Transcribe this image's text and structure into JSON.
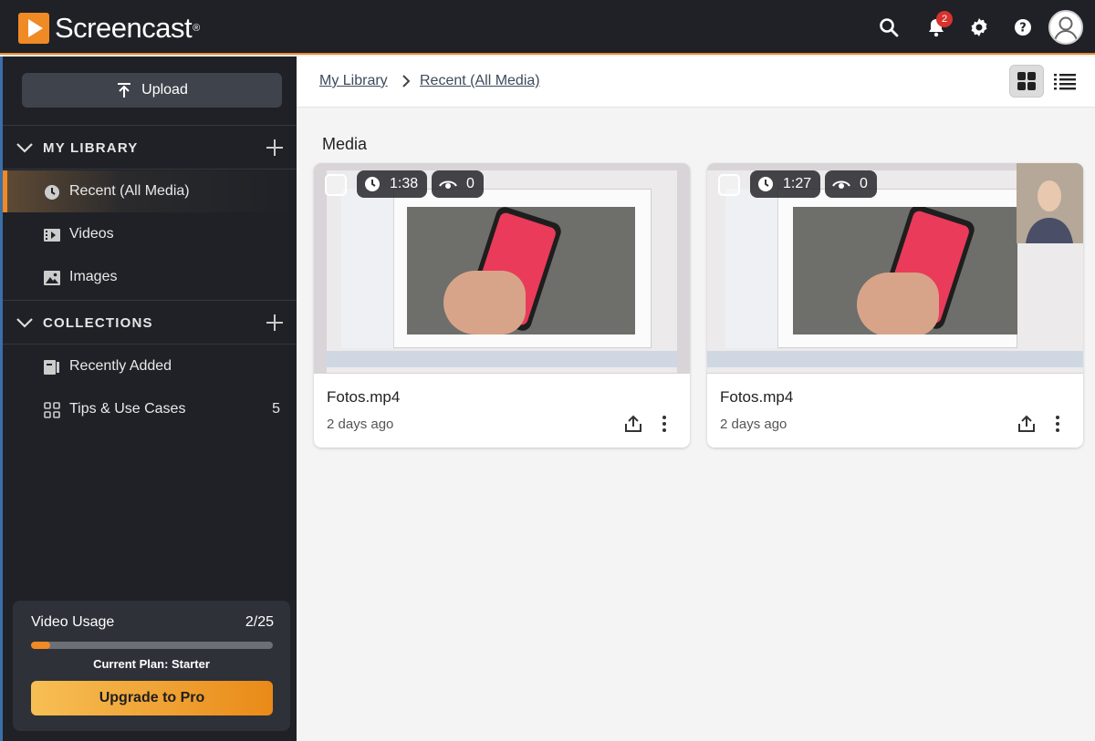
{
  "app": {
    "name": "Screencast",
    "registered_mark": "®",
    "notifications_count": "2"
  },
  "sidebar": {
    "upload_label": "Upload",
    "my_library": {
      "title": "MY LIBRARY",
      "items": [
        {
          "label": "Recent (All Media)",
          "icon": "clock-icon",
          "active": true
        },
        {
          "label": "Videos",
          "icon": "film-icon"
        },
        {
          "label": "Images",
          "icon": "image-icon"
        }
      ]
    },
    "collections": {
      "title": "COLLECTIONS",
      "items": [
        {
          "label": "Recently Added",
          "icon": "collection-icon"
        },
        {
          "label": "Tips & Use Cases",
          "icon": "grid-icon",
          "count": "5"
        }
      ]
    },
    "usage": {
      "title": "Video Usage",
      "count": "2/25",
      "fraction": 0.08,
      "plan": "Current Plan: Starter",
      "upgrade_label": "Upgrade to Pro"
    }
  },
  "breadcrumb": {
    "items": [
      "My Library",
      "Recent (All Media)"
    ]
  },
  "main": {
    "section_label": "Media",
    "cards": [
      {
        "title": "Fotos.mp4",
        "date": "2 days ago",
        "duration": "1:38",
        "views": "0",
        "has_webcam": false
      },
      {
        "title": "Fotos.mp4",
        "date": "2 days ago",
        "duration": "1:27",
        "views": "0",
        "has_webcam": true
      }
    ]
  },
  "colors": {
    "accent": "#f08a24",
    "topbar": "#1f2127",
    "sidebar": "#1f2127",
    "badge": "#d8322f"
  }
}
